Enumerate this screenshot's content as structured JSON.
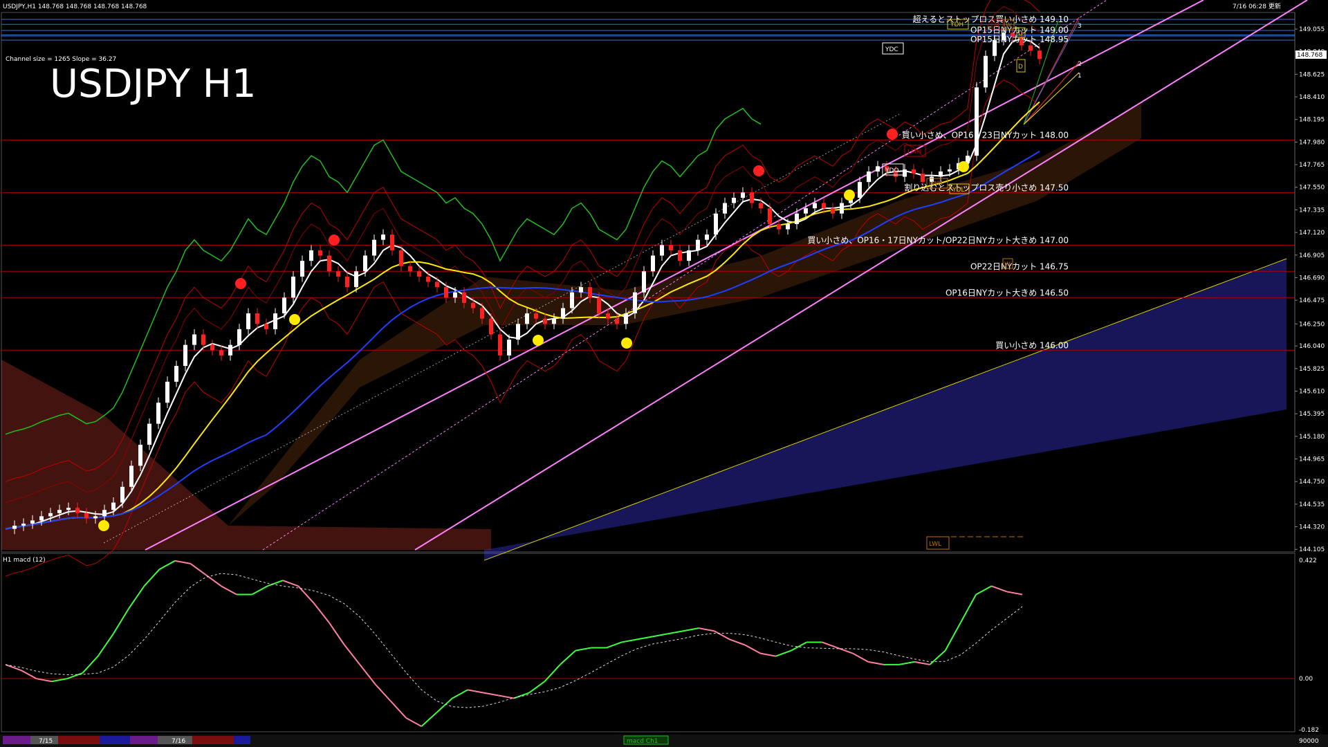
{
  "header": {
    "symbol_info": "USDJPY,H1  148.768 148.768 148.768 148.768",
    "timestamp": "7/16 06:28 更新",
    "channel_info": "Channel size = 1265 Slope = 36.27",
    "big_title": "USDJPY H1",
    "price_tag": "148.768"
  },
  "chart_data": {
    "type": "line",
    "title": "USDJPY H1",
    "ylim": [
      144.1,
      149.2
    ],
    "price_ticks": [
      "149.055",
      "148.840",
      "148.625",
      "148.410",
      "148.195",
      "147.980",
      "147.765",
      "147.550",
      "147.335",
      "147.120",
      "146.905",
      "146.690",
      "146.475",
      "146.250",
      "146.040",
      "145.825",
      "145.610",
      "145.395",
      "145.180",
      "144.965",
      "144.750",
      "144.535",
      "144.320",
      "144.105"
    ],
    "levels": [
      {
        "label": "超えるとストップロス買い小さめ 149.10",
        "value": 149.1
      },
      {
        "label": "OP15日NYカット 149.00",
        "value": 149.0
      },
      {
        "label": "OP15日NYカット 148.95",
        "value": 148.95
      },
      {
        "label": "買い小さめ、OP16・23日NYカット 148.00",
        "value": 148.0
      },
      {
        "label": "割り込むとストップロス売り小さめ 147.50",
        "value": 147.5
      },
      {
        "label": "買い小さめ、OP16・17日NYカット/OP22日NYカット大きめ 147.00",
        "value": 147.0
      },
      {
        "label": "OP22日NYカット 146.75",
        "value": 146.75
      },
      {
        "label": "OP16日NYカット大きめ 146.50",
        "value": 146.5
      },
      {
        "label": "買い小さめ 146.00",
        "value": 146.0
      }
    ],
    "close_series": [
      144.3,
      144.33,
      144.35,
      144.38,
      144.42,
      144.45,
      144.48,
      144.5,
      144.45,
      144.4,
      144.42,
      144.48,
      144.55,
      144.7,
      144.9,
      145.1,
      145.3,
      145.5,
      145.7,
      145.85,
      146.05,
      146.15,
      146.05,
      146.0,
      145.95,
      146.05,
      146.2,
      146.35,
      146.25,
      146.2,
      146.35,
      146.5,
      146.7,
      146.85,
      146.95,
      146.9,
      146.75,
      146.7,
      146.6,
      146.75,
      146.9,
      147.05,
      147.1,
      146.95,
      146.8,
      146.75,
      146.7,
      146.65,
      146.6,
      146.5,
      146.55,
      146.45,
      146.4,
      146.3,
      146.15,
      145.95,
      146.1,
      146.25,
      146.35,
      146.3,
      146.25,
      146.3,
      146.4,
      146.55,
      146.6,
      146.5,
      146.35,
      146.3,
      146.25,
      146.35,
      146.55,
      146.75,
      146.9,
      147.0,
      146.95,
      146.85,
      146.95,
      147.05,
      147.1,
      147.3,
      147.4,
      147.45,
      147.5,
      147.4,
      147.35,
      147.2,
      147.15,
      147.2,
      147.3,
      147.35,
      147.4,
      147.35,
      147.3,
      147.4,
      147.45,
      147.6,
      147.7,
      147.75,
      147.7,
      147.65,
      147.72,
      147.68,
      147.6,
      147.65,
      147.7,
      147.72,
      147.78,
      147.85,
      148.5,
      148.8,
      148.95,
      149.02,
      148.98,
      148.9,
      148.85,
      148.77
    ],
    "macd_axis": [
      "0.422",
      "0.00",
      "-0.182"
    ],
    "macd_series": [
      0.05,
      0.03,
      0.0,
      -0.01,
      0.0,
      0.02,
      0.08,
      0.16,
      0.25,
      0.33,
      0.39,
      0.42,
      0.41,
      0.37,
      0.33,
      0.3,
      0.3,
      0.33,
      0.35,
      0.33,
      0.27,
      0.2,
      0.12,
      0.05,
      -0.02,
      -0.08,
      -0.14,
      -0.17,
      -0.12,
      -0.07,
      -0.04,
      -0.05,
      -0.06,
      -0.07,
      -0.05,
      -0.01,
      0.05,
      0.1,
      0.11,
      0.11,
      0.13,
      0.14,
      0.15,
      0.16,
      0.17,
      0.18,
      0.17,
      0.14,
      0.12,
      0.09,
      0.08,
      0.1,
      0.13,
      0.13,
      0.11,
      0.09,
      0.06,
      0.05,
      0.05,
      0.06,
      0.05,
      0.1,
      0.2,
      0.3,
      0.33,
      0.31,
      0.3
    ],
    "macd_label": "H1 macd (12)"
  },
  "markers": {
    "ydh": "YDH",
    "ydc": "YDC",
    "ydo": "YDO",
    "ydl": "YDL",
    "lmh": "LMH",
    "lwh": "LWH",
    "lwl": "LWL",
    "m": "M",
    "w": "W",
    "d": "D",
    "fan_3": "3",
    "fan_2": "2",
    "fan_1": "1"
  },
  "bottom_bar": {
    "date1": "7/15",
    "date2": "7/16",
    "indicator_label": "macd Ch1",
    "right_value": "90000"
  },
  "colors": {
    "background": "#000000",
    "ichimoku_cloud_bull": "#4040ff",
    "ichimoku_cloud_bear": "#c0392b",
    "ma_white": "#ffffff",
    "ma_yellow": "#ffea00",
    "ma_blue": "#1f3fff",
    "chikou": "#1fbf1f",
    "channel": "#ff80ff",
    "level_red": "#b00000",
    "level_blue": "#3a6fd8",
    "candle_up": "#ffffff",
    "candle_down": "#ff2020",
    "macd_up": "#3dff3d",
    "macd_down": "#ff7fa0"
  }
}
